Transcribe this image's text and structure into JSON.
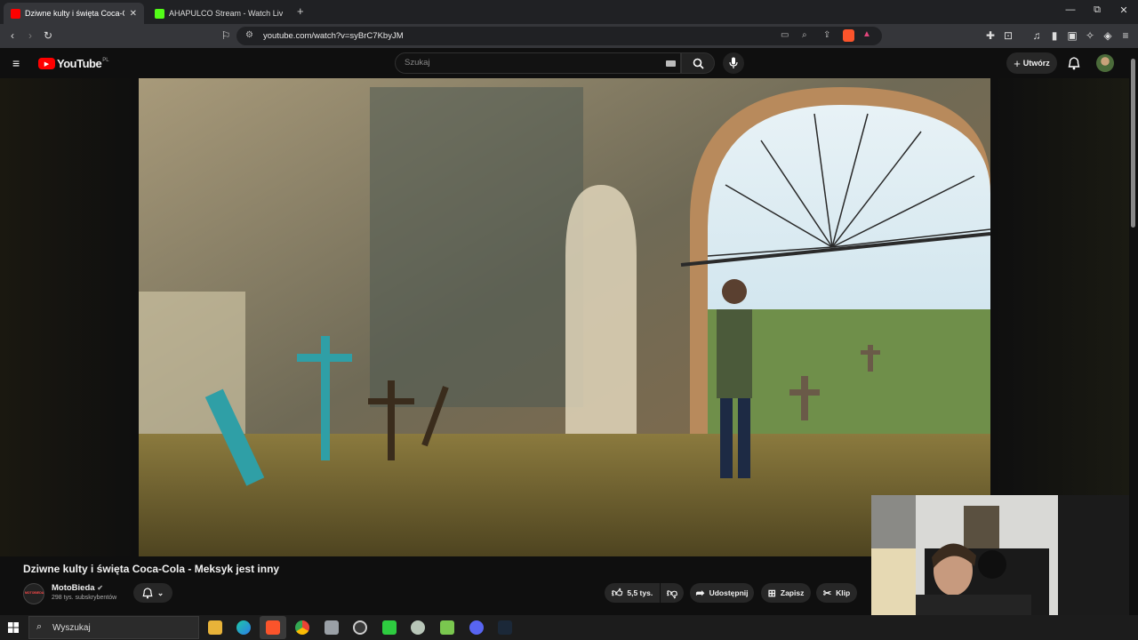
{
  "browser": {
    "tabs": [
      {
        "title": "Dziwne kulty i święta Coca-Co",
        "active": true
      },
      {
        "title": "AHAPULCO Stream - Watch Live on K",
        "active": false
      }
    ],
    "new_tab": "+",
    "url": "youtube.com/watch?v=syBrC7KbyJM",
    "controls": {
      "minimize": "—",
      "restore": "⧉",
      "close": "✕"
    }
  },
  "youtube": {
    "logo_text": "YouTube",
    "logo_region": "PL",
    "search_placeholder": "Szukaj",
    "create_label": "Utwórz",
    "video_title": "Dziwne kulty i święta Coca-Cola - Meksyk jest inny",
    "channel": {
      "name": "MotoBieda",
      "subscribers": "298 tys. subskrybentów",
      "avatar_text": "MOTOBIEDA"
    },
    "actions": {
      "likes": "5,5 tys.",
      "share": "Udostępnij",
      "save": "Zapisz",
      "clip": "Klip"
    }
  },
  "taskbar": {
    "search_placeholder": "Wyszukaj"
  },
  "colors": {
    "yt_red": "#ff0000",
    "background": "#0f0f0f",
    "pill": "#272727"
  }
}
